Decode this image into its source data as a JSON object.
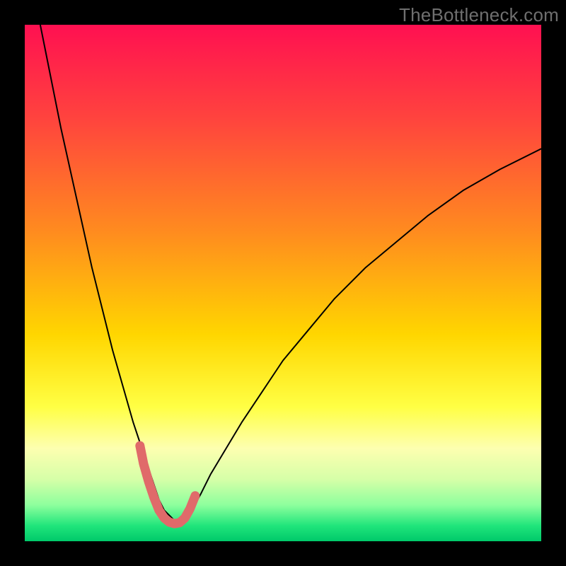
{
  "watermark": "TheBottleneck.com",
  "chart_data": {
    "type": "line",
    "title": "",
    "xlabel": "",
    "ylabel": "",
    "xlim": [
      0,
      100
    ],
    "ylim": [
      0,
      100
    ],
    "grid": false,
    "legend": false,
    "gradient_stops": [
      {
        "offset": 0.0,
        "color": "#ff1051"
      },
      {
        "offset": 0.18,
        "color": "#ff433e"
      },
      {
        "offset": 0.4,
        "color": "#ff8b1f"
      },
      {
        "offset": 0.6,
        "color": "#ffd600"
      },
      {
        "offset": 0.74,
        "color": "#ffff44"
      },
      {
        "offset": 0.82,
        "color": "#fdffb0"
      },
      {
        "offset": 0.88,
        "color": "#d6ffa8"
      },
      {
        "offset": 0.93,
        "color": "#8dff9d"
      },
      {
        "offset": 0.97,
        "color": "#20e57b"
      },
      {
        "offset": 1.0,
        "color": "#00c96a"
      }
    ],
    "series": [
      {
        "name": "curve",
        "color": "#000000",
        "width": 2,
        "x": [
          3,
          5,
          7,
          9,
          11,
          13,
          15,
          17,
          19,
          21,
          22,
          23,
          24,
          25,
          26,
          27,
          28,
          29,
          30,
          31,
          32,
          34,
          36,
          39,
          42,
          46,
          50,
          55,
          60,
          66,
          72,
          78,
          85,
          92,
          100
        ],
        "y": [
          100,
          90,
          80,
          71,
          62,
          53,
          45,
          37,
          30,
          23,
          20,
          17,
          14,
          11,
          8,
          6,
          5,
          4,
          3.5,
          3.9,
          5.5,
          9,
          13,
          18,
          23,
          29,
          35,
          41,
          47,
          53,
          58,
          63,
          68,
          72,
          76
        ]
      },
      {
        "name": "highlight",
        "color": "#e06a6a",
        "width": 13,
        "type": "line_rounded",
        "x": [
          22.3,
          23.0,
          24.0,
          25.0,
          26.0,
          27.0,
          28.0,
          29.0,
          30.0,
          31.0,
          32.0,
          33.0
        ],
        "y": [
          18.5,
          15.0,
          11.5,
          8.5,
          6.0,
          4.5,
          3.7,
          3.4,
          3.6,
          4.5,
          6.3,
          8.8
        ]
      }
    ]
  }
}
